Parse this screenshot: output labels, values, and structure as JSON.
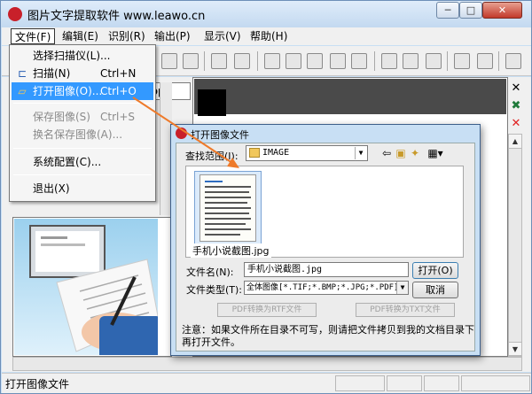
{
  "window": {
    "title": "图片文字提取软件 www.leawo.cn",
    "min_glyph": "─",
    "max_glyph": "□",
    "close_glyph": "✕",
    "logo_glyph": ""
  },
  "menubar": [
    {
      "label": "文件(F)"
    },
    {
      "label": "编辑(E)"
    },
    {
      "label": "识别(R)"
    },
    {
      "label": "输出(P)"
    },
    {
      "label": "显示(V)"
    },
    {
      "label": "帮助(H)"
    }
  ],
  "file_menu": {
    "items": [
      {
        "label": "选择扫描仪(L)...",
        "shortcut": "",
        "enabled": true
      },
      {
        "label": "扫描(N)",
        "shortcut": "Ctrl+N",
        "enabled": true,
        "icon": "scan-icon",
        "icon_glyph": "⊏"
      },
      {
        "label": "打开图像(O)...",
        "shortcut": "Ctrl+O",
        "enabled": true,
        "highlighted": true,
        "icon": "open-folder-icon",
        "icon_glyph": "▱"
      },
      {
        "label": "保存图像(S)",
        "shortcut": "Ctrl+S",
        "enabled": false
      },
      {
        "label": "换名保存图像(A)...",
        "shortcut": "",
        "enabled": false
      },
      {
        "label": "系统配置(C)...",
        "shortcut": "",
        "enabled": true
      },
      {
        "label": "退出(X)",
        "shortcut": "",
        "enabled": true
      }
    ]
  },
  "path_field": {
    "value": "ktop\\"
  },
  "right_icons": [
    {
      "name": "close-panel-icon",
      "glyph": "✕",
      "color": "#000000"
    },
    {
      "name": "excel-icon",
      "glyph": "✖",
      "color": "#1f7a3a"
    },
    {
      "name": "red-x-icon",
      "glyph": "✕",
      "color": "#e02020"
    }
  ],
  "status_bar": {
    "text": "打开图像文件"
  },
  "dialog": {
    "title": "打开图像文件",
    "look_in_label": "查找范围(I):",
    "look_in_value": "IMAGE",
    "nav_icons": [
      "back-icon",
      "up-folder-icon",
      "new-folder-icon",
      "view-menu-icon"
    ],
    "nav_glyphs": [
      "⇦",
      "▣",
      "✦",
      "▦▾"
    ],
    "file_item": {
      "name": "手机小说截图.jpg"
    },
    "filename_label": "文件名(N):",
    "filename_value": "手机小说截图.jpg",
    "filetype_label": "文件类型(T):",
    "filetype_value": "全体图像[*.TIF;*.BMP;*.JPG;*.PDF]",
    "open_button": "打开(O)",
    "cancel_button": "取消",
    "rtf_button": "PDF转换为RTF文件",
    "txt_button": "PDF转换为TXT文件",
    "note": "注意：如果文件所在目录不可写，则请把文件拷贝到我的文档目录下再打开文件。"
  },
  "colors": {
    "accent": "#3399ff",
    "arrow": "#ee7a2a",
    "title_bg": "#c8dff4"
  }
}
